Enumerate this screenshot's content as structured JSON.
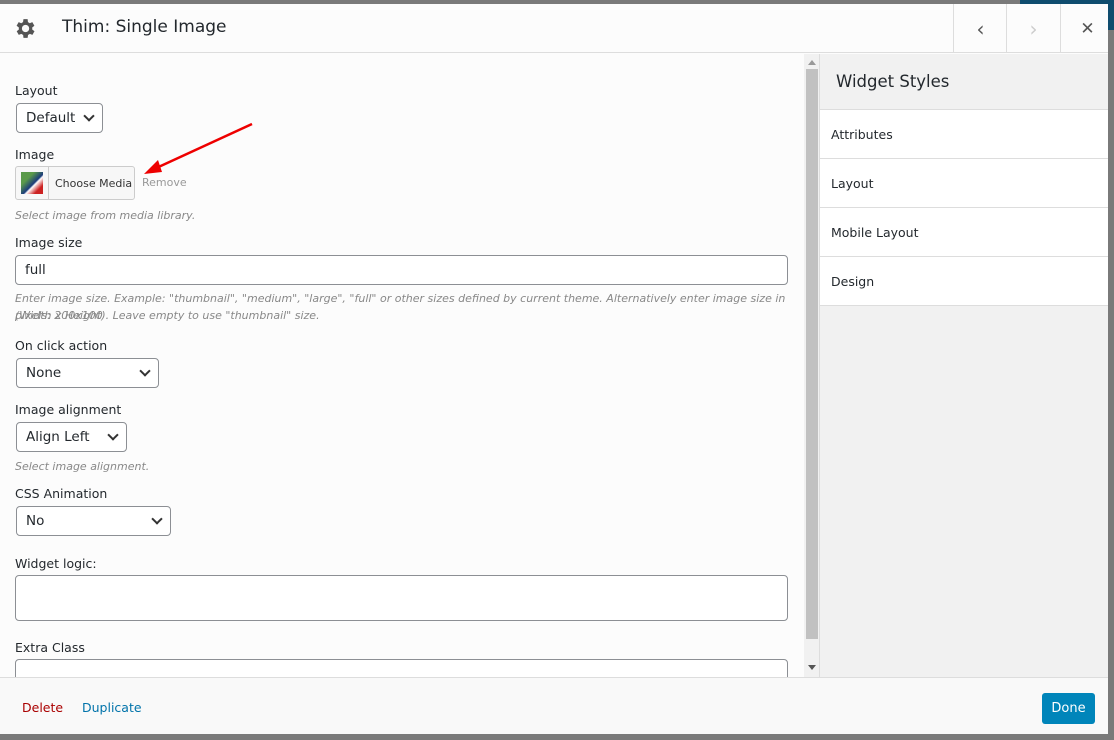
{
  "header": {
    "title": "Thim: Single Image"
  },
  "fields": {
    "layout": {
      "label": "Layout",
      "value": "Default"
    },
    "image": {
      "label": "Image",
      "button": "Choose Media",
      "remove": "Remove",
      "desc": "Select image from media library."
    },
    "image_size": {
      "label": "Image size",
      "value": "full",
      "desc1": "Enter image size. Example: \"thumbnail\", \"medium\", \"large\", \"full\" or other sizes defined by current theme. Alternatively enter image size in pixels: 200x100",
      "desc2": "(Width x Height). Leave empty to use \"thumbnail\" size."
    },
    "on_click": {
      "label": "On click action",
      "value": "None"
    },
    "alignment": {
      "label": "Image alignment",
      "value": "Align Left",
      "desc": "Select image alignment."
    },
    "animation": {
      "label": "CSS Animation",
      "value": "No"
    },
    "widget_logic": {
      "label": "Widget logic:",
      "value": ""
    },
    "extra_class": {
      "label": "Extra Class",
      "value": ""
    }
  },
  "sidebar": {
    "title": "Widget Styles",
    "items": [
      {
        "label": "Attributes"
      },
      {
        "label": "Layout"
      },
      {
        "label": "Mobile Layout"
      },
      {
        "label": "Design"
      }
    ]
  },
  "footer": {
    "delete": "Delete",
    "duplicate": "Duplicate",
    "done": "Done"
  },
  "colors": {
    "accent": "#0085ba",
    "delete": "#a00",
    "link": "#0073aa",
    "arrow": "#e00"
  }
}
